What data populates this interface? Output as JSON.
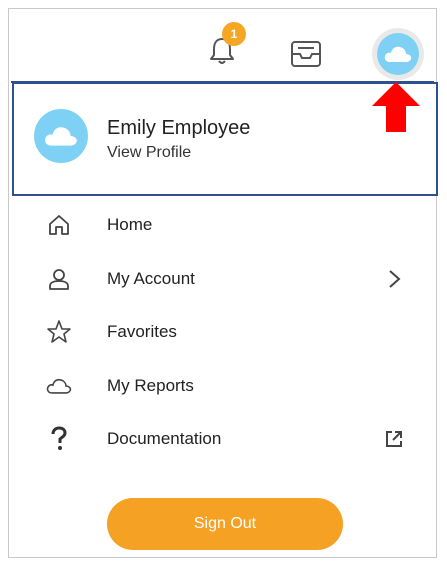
{
  "header": {
    "notifications": {
      "icon": "bell-icon",
      "count": "1"
    },
    "inbox": {
      "icon": "inbox-icon"
    },
    "avatar": {
      "icon": "cloud-icon"
    },
    "annotation": {
      "icon": "red-arrow-up-icon"
    }
  },
  "profile": {
    "name": "Emily Employee",
    "link": "View Profile",
    "icon": "cloud-icon"
  },
  "menu": {
    "items": [
      {
        "label": "Home",
        "icon": "home-icon"
      },
      {
        "label": "My Account",
        "icon": "person-icon",
        "trailing": "chevron-right-icon"
      },
      {
        "label": "Favorites",
        "icon": "star-icon"
      },
      {
        "label": "My Reports",
        "icon": "cloud-outline-icon"
      },
      {
        "label": "Documentation",
        "icon": "question-icon",
        "trailing": "external-link-icon"
      }
    ]
  },
  "actions": {
    "sign_out": "Sign Out"
  },
  "colors": {
    "accent": "#f5a123",
    "avatar": "#7fd0f5",
    "highlight_border": "#2f4f8f",
    "arrow": "#ff0000"
  }
}
